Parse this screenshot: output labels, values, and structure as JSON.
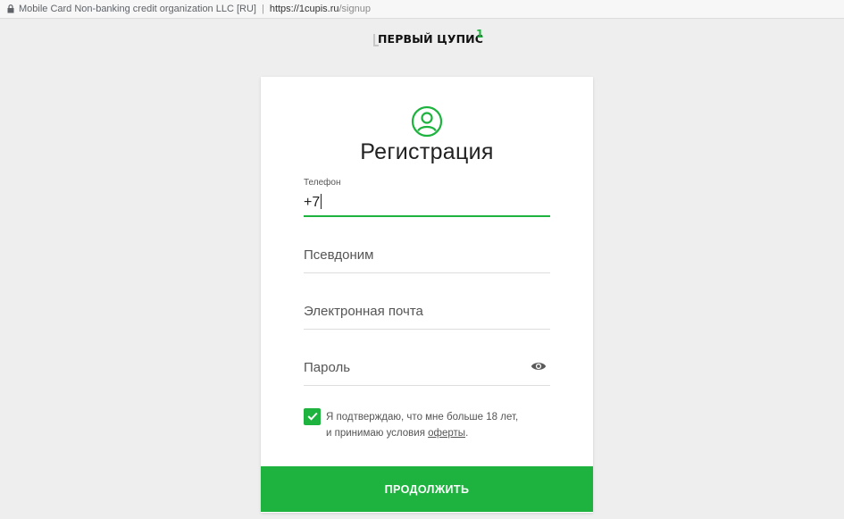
{
  "browser": {
    "org": "Mobile Card Non-banking credit organization LLC [RU]",
    "separator": "|",
    "url_host": "https://1cupis.ru",
    "url_path": "/signup"
  },
  "logo": {
    "text": "ПЕРВЫЙ ЦУПИС",
    "mark": "1"
  },
  "form": {
    "title": "Регистрация",
    "phone": {
      "label": "Телефон",
      "value": "+7"
    },
    "nickname": {
      "placeholder": "Псевдоним"
    },
    "email": {
      "placeholder": "Электронная почта"
    },
    "password": {
      "placeholder": "Пароль"
    },
    "consent": {
      "checked": true,
      "line1": "Я подтверждаю, что мне больше 18 лет,",
      "line2_prefix": "и принимаю условия ",
      "link": "оферты",
      "line2_suffix": "."
    },
    "submit_label": "ПРОДОЛЖИТЬ"
  },
  "colors": {
    "accent": "#1db33e",
    "background": "#eeeeee",
    "card": "#ffffff"
  },
  "icons": [
    "lock-icon",
    "user-icon",
    "eye-icon",
    "check-icon"
  ]
}
